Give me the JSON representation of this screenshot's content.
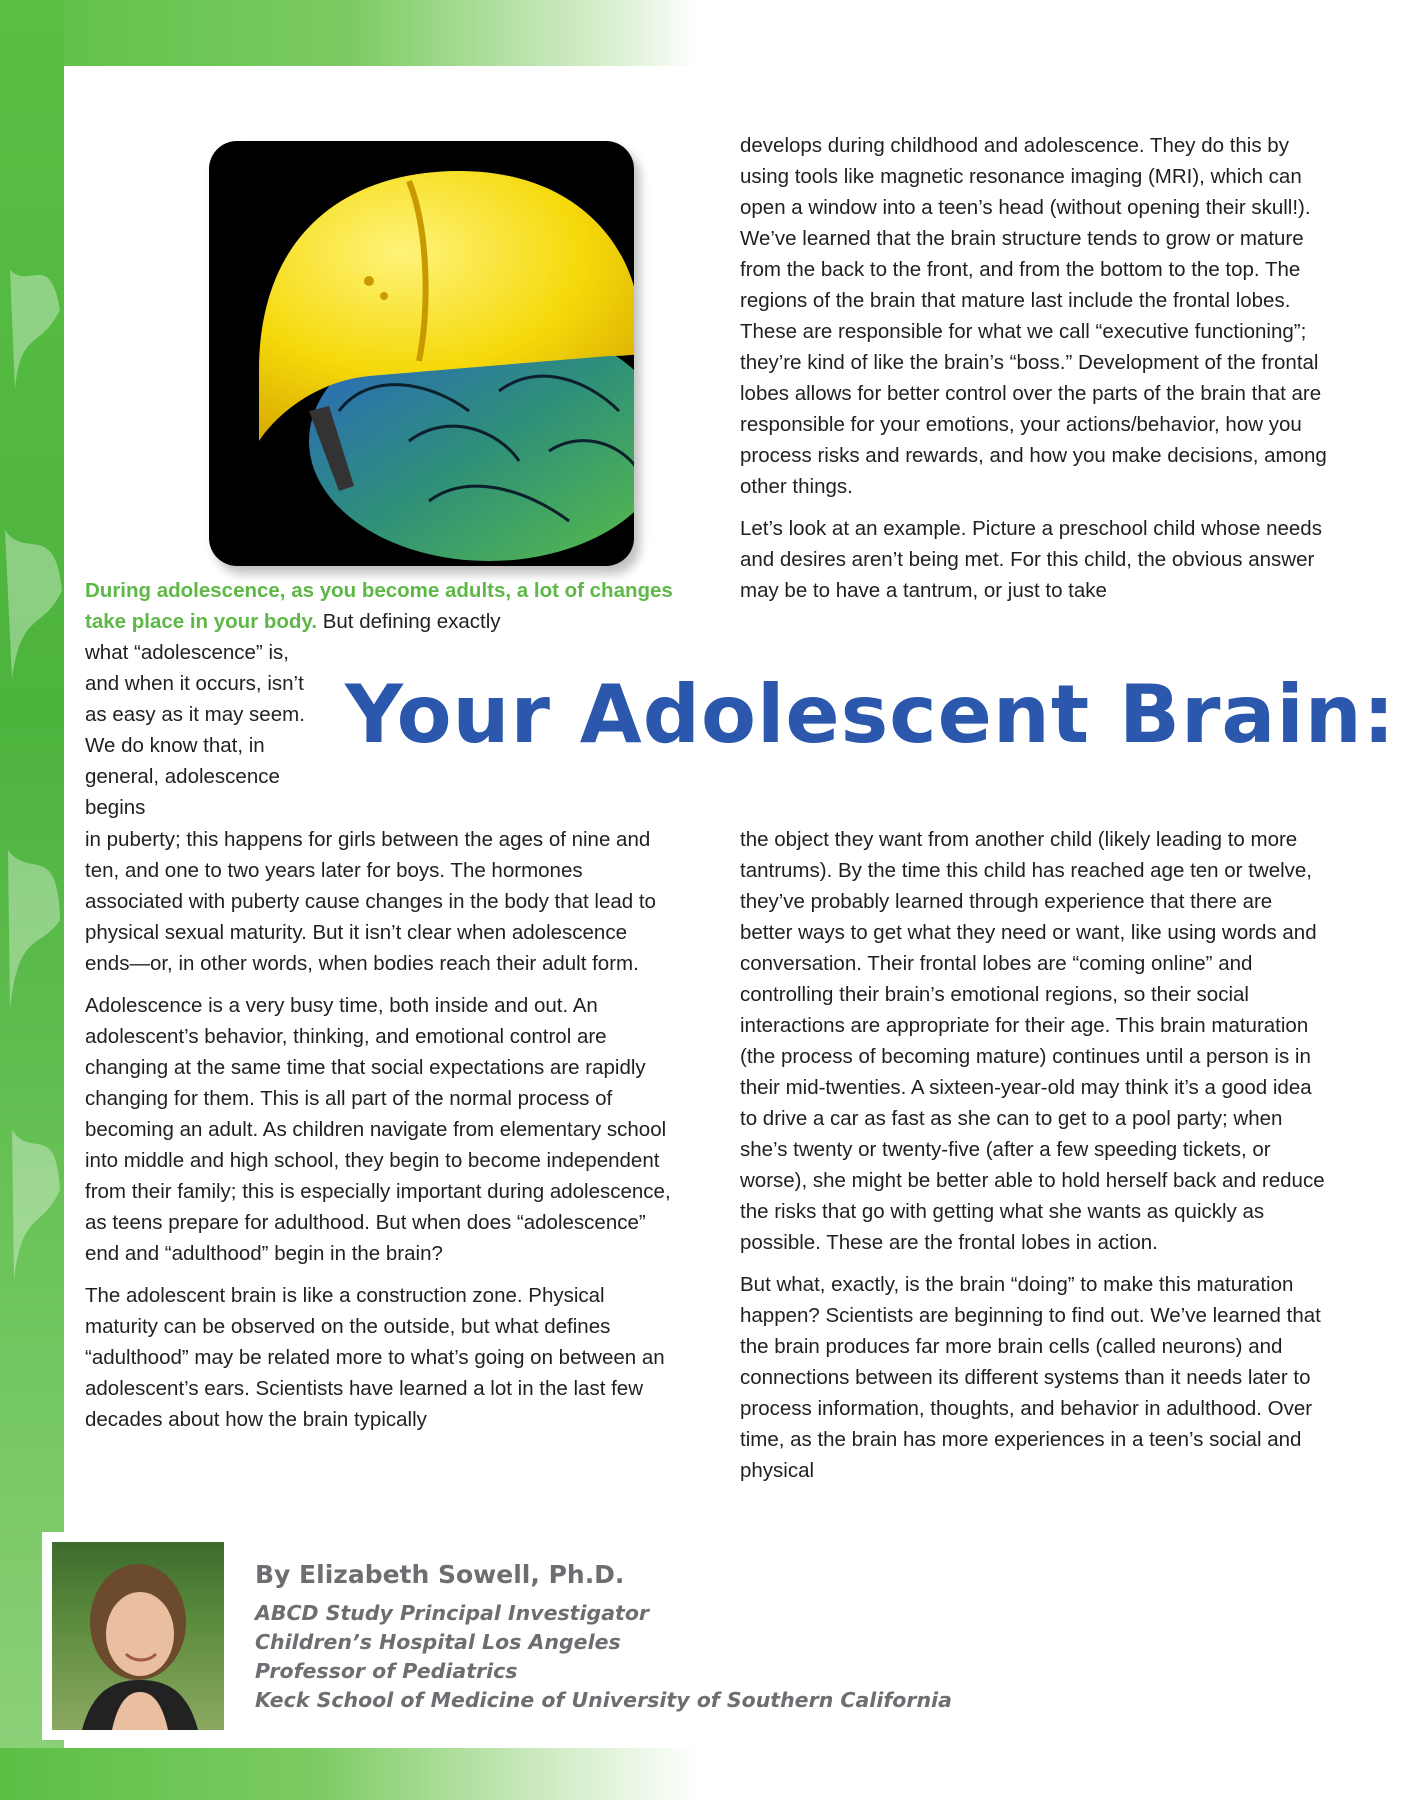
{
  "article": {
    "title": "Your Adolescent Brain:",
    "intro_lead": "During adolescence, as you become adults, a lot of changes take place in your body.",
    "intro_rest": "But defining exactly",
    "narrow_text": "what “adolescence” is, and when it occurs, isn’t as easy as it may seem. We do know that, in general, adolescence begins",
    "left_paragraphs": [
      "in puberty; this happens for girls between the ages of nine and ten, and one to two years later for boys. The hormones associated with puberty cause changes in the body that lead to physical sexual maturity. But it isn’t clear when adolescence ends—or, in other words, when bodies reach their adult form.",
      "Adolescence is a very busy time, both inside and out. An adolescent’s behavior, thinking, and emotional control are changing at the same time that social expectations are rapidly changing for them. This is all part of the normal process of becoming an adult. As children navigate from elementary school into middle and high school, they begin to become independent from their family; this is especially important during adolescence, as teens prepare for adulthood. But when does “adolescence” end and “adulthood” begin in the brain?",
      "The adolescent brain is like a construction zone. Physical maturity can be observed on the outside, but what defines “adulthood” may be related more to what’s going on between an adolescent’s ears. Scientists have learned a lot in the last few decades about how the brain typically"
    ],
    "right_top_paragraphs": [
      "develops during childhood and adolescence. They do this by using tools like magnetic resonance imaging (MRI), which can open a window into a teen’s head (without opening their skull!). We’ve learned that the brain structure tends to grow or mature from the back to the front, and from the bottom to the top. The regions of the brain that mature last include the frontal lobes. These are responsible for what we call “executive functioning”; they’re kind of like the brain’s “boss.” Development of the frontal lobes allows for better control over the parts of the brain that are responsible for your emotions, your actions/behavior, how you process risks and rewards, and how you make decisions, among other things.",
      "Let’s look at an example. Picture a preschool child whose needs and desires aren’t being met. For this child, the obvious answer may be to have a tantrum, or just to take"
    ],
    "right_bottom_paragraphs": [
      "the object they want from another child (likely leading to more tantrums). By the time this child has reached age ten or twelve, they’ve probably learned through experience that there are better ways to get what they need or want, like using words and conversation. Their frontal lobes are “coming online” and controlling their brain’s emotional regions, so their social interactions are appropriate for their age. This brain maturation (the process of becoming mature) continues until a person is in their mid-twenties. A sixteen-year-old may think it’s a good idea to drive a car as fast as she can to get to a pool party; when she’s twenty or twenty-five (after a few speeding tickets, or worse), she might be better able to hold herself back and reduce the risks that go with getting what she wants as quickly as possible. These are the frontal lobes in action.",
      "But what, exactly, is the brain “doing” to make this maturation happen? Scientists are beginning to find out. We’ve learned that the brain produces far more brain cells (called neurons) and connections between its different systems than it needs later to process information, thoughts, and behavior in adulthood. Over time, as the brain has more experiences in a teen’s social and physical"
    ]
  },
  "author": {
    "name": "By Elizabeth Sowell, Ph.D.",
    "affiliations": [
      "ABCD Study Principal Investigator",
      "Children’s Hospital Los Angeles",
      "Professor of Pediatrics",
      "Keck School of Medicine of University of Southern California"
    ]
  },
  "colors": {
    "accent_green": "#5db846",
    "title_blue": "#2b57ac",
    "helmet_yellow": "#f5d90a"
  },
  "icons": {
    "hero": "hardhat-brain-illustration",
    "portrait": "author-photo"
  }
}
